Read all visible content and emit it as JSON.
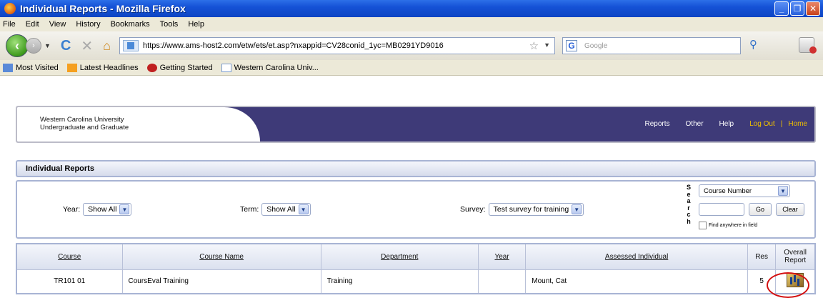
{
  "window": {
    "title": "Individual Reports - Mozilla Firefox"
  },
  "menubar": {
    "items": [
      "File",
      "Edit",
      "View",
      "History",
      "Bookmarks",
      "Tools",
      "Help"
    ]
  },
  "navbar": {
    "url": "https://www.ams-host2.com/etw/ets/et.asp?nxappid=CV28conid_1yc=MB0291YD9016",
    "search_placeholder": "Google"
  },
  "bookmarks": [
    "Most Visited",
    "Latest Headlines",
    "Getting Started",
    "Western Carolina Univ..."
  ],
  "banner": {
    "university": "Western Carolina University",
    "subtitle": "Undergraduate and Graduate",
    "nav": {
      "reports": "Reports",
      "other": "Other",
      "help": "Help",
      "logout": "Log Out",
      "separator": "|",
      "home": "Home"
    }
  },
  "section": {
    "title": "Individual Reports"
  },
  "filters": {
    "year_label": "Year:",
    "year_value": "Show All",
    "term_label": "Term:",
    "term_value": "Show All",
    "survey_label": "Survey:",
    "survey_value": "Test survey for training"
  },
  "search": {
    "vertical_label": [
      "S",
      "e",
      "a",
      "r",
      "c",
      "h"
    ],
    "field_value": "Course Number",
    "go_label": "Go",
    "clear_label": "Clear",
    "anywhere_label": "Find anywhere in field"
  },
  "table": {
    "headers": [
      "Course",
      "Course Name",
      "Department",
      "Year",
      "Assessed Individual",
      "Res",
      "Overall Report"
    ],
    "rows": [
      {
        "course": "TR101 01",
        "course_name": "CoursEval Training",
        "department": "Training",
        "year": "",
        "assessed": "Mount, Cat",
        "res": "5"
      }
    ]
  },
  "colors": {
    "banner_bg": "#3e3a78",
    "accent_gold": "#f0c000",
    "annotation_circle": "#d41010"
  }
}
